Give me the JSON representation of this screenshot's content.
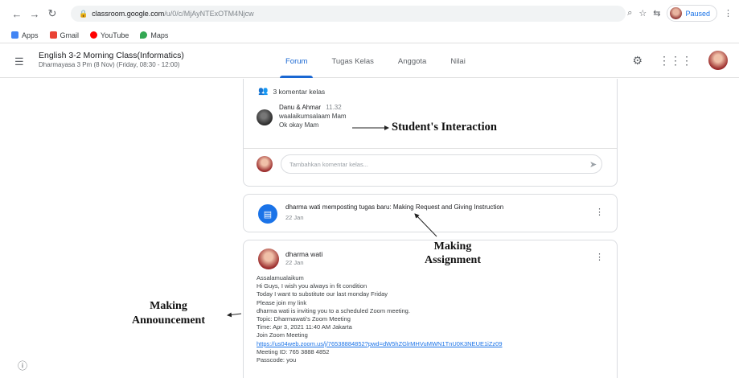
{
  "browser": {
    "url_host": "classroom.google.com",
    "url_path": "/u/0/c/MjAyNTExOTM4Njcw",
    "profile_label": "Paused",
    "bookmarks": [
      {
        "label": "Apps",
        "icon": "apps-grid-icon",
        "color": "#4285f4"
      },
      {
        "label": "Gmail",
        "icon": "gmail-icon",
        "color": "#ea4335"
      },
      {
        "label": "YouTube",
        "icon": "youtube-icon",
        "color": "#ff0000"
      },
      {
        "label": "Maps",
        "icon": "maps-pin-icon",
        "color": "#34a853"
      }
    ]
  },
  "header": {
    "class_title": "English 3-2 Morning Class(Informatics)",
    "class_subtitle": "Dharmayasa 3 Pm (8 Nov) (Friday, 08:30 - 12:00)",
    "tabs": [
      "Forum",
      "Tugas Kelas",
      "Anggota",
      "Nilai"
    ],
    "active_tab": "Forum"
  },
  "comments_card": {
    "count_label": "3 komentar kelas",
    "comment": {
      "name": "Danu & Ahmar",
      "time": "11.32",
      "lines": [
        "waalaikumsalaam Mam",
        "Ok okay Mam"
      ]
    },
    "reply_placeholder": "Tambahkan komentar kelas..."
  },
  "assignment_card": {
    "text": "dharma wati memposting tugas baru: Making Request and Giving Instruction",
    "date": "22 Jan"
  },
  "announcement_card": {
    "author": "dharma wati",
    "date": "22 Jan",
    "lines": [
      "Assalamualaikum",
      "Hi Guys, I wish you always in fit condition",
      "Today I want to substitute our last monday Friday",
      "Please join my link",
      "dharma wati is inviting you to a scheduled Zoom meeting.",
      "Topic: Dharmawati's Zoom Meeting",
      "Time: Apr 3, 2021 11:40 AM Jakarta",
      "Join Zoom Meeting"
    ],
    "link": "https://us04web.zoom.us/j/76538884852?pwd=dW5hZGlrMHVuMWN1TnU0K3NEUE1iZz09",
    "trailing_lines": [
      "Meeting ID: 765 3888 4852",
      "Passcode: you"
    ]
  },
  "annotations": {
    "student": "Student's Interaction",
    "assignment": [
      "Making",
      "Assignment"
    ],
    "announcement": [
      "Making",
      "Announcement"
    ]
  }
}
